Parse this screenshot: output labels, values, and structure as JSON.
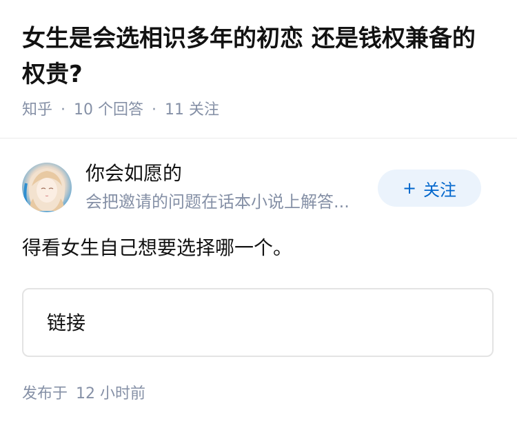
{
  "question": {
    "title": "女生是会选相识多年的初恋 还是钱权兼备的权贵?",
    "source": "知乎",
    "answer_count": "10 个回答",
    "follow_count": "11 关注"
  },
  "author": {
    "name": "你会如愿的",
    "bio": "会把邀请的问题在话本小说上解答...",
    "avatar_icon": "anime-girl-avatar",
    "follow_button": {
      "plus": "+",
      "label": "关注"
    }
  },
  "answer": {
    "text": "得看女生自己想要选择哪一个。",
    "link_card_label": "链接"
  },
  "footer": {
    "publish_prefix": "发布于",
    "publish_time": "12 小时前"
  },
  "colors": {
    "accent": "#0066cc",
    "follow_bg": "#ebf3fc",
    "meta_gray": "#8590a6"
  }
}
